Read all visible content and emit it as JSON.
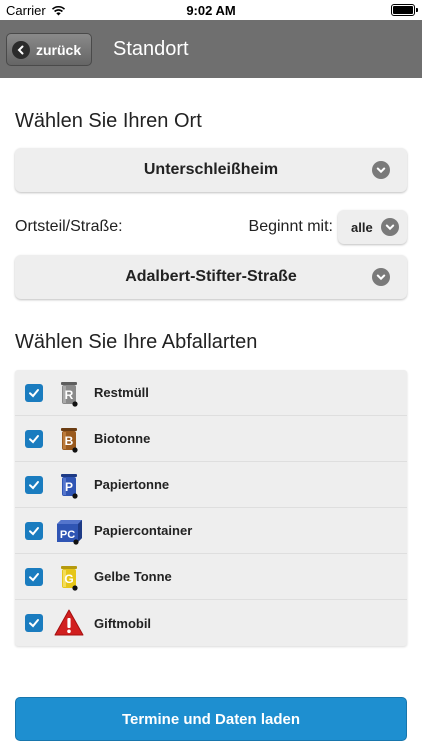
{
  "status": {
    "carrier": "Carrier",
    "time": "9:02 AM"
  },
  "nav": {
    "back_label": "zurück",
    "title": "Standort"
  },
  "location": {
    "heading": "Wählen Sie Ihren Ort",
    "city_value": "Unterschleißheim",
    "district_label": "Ortsteil/Straße:",
    "starts_with_label": "Beginnt mit:",
    "starts_with_value": "alle",
    "street_value": "Adalbert-Stifter-Straße"
  },
  "waste": {
    "heading": "Wählen Sie Ihre Abfallarten",
    "items": [
      {
        "label": "Restmüll",
        "checked": true,
        "icon": "restmuell-bin-icon",
        "letter": "R",
        "color": "#8a8a8a"
      },
      {
        "label": "Biotonne",
        "checked": true,
        "icon": "biotonne-bin-icon",
        "letter": "B",
        "color": "#9a5a1e"
      },
      {
        "label": "Papiertonne",
        "checked": true,
        "icon": "papiertonne-bin-icon",
        "letter": "P",
        "color": "#2f55b4"
      },
      {
        "label": "Papiercontainer",
        "checked": true,
        "icon": "papiercontainer-icon",
        "letter": "PC",
        "color": "#2f55b4"
      },
      {
        "label": "Gelbe Tonne",
        "checked": true,
        "icon": "gelbe-tonne-bin-icon",
        "letter": "G",
        "color": "#e6c619"
      },
      {
        "label": "Giftmobil",
        "checked": true,
        "icon": "warning-triangle-icon",
        "letter": "!",
        "color": "#d11f1f"
      }
    ]
  },
  "cta": {
    "label": "Termine und Daten laden"
  }
}
